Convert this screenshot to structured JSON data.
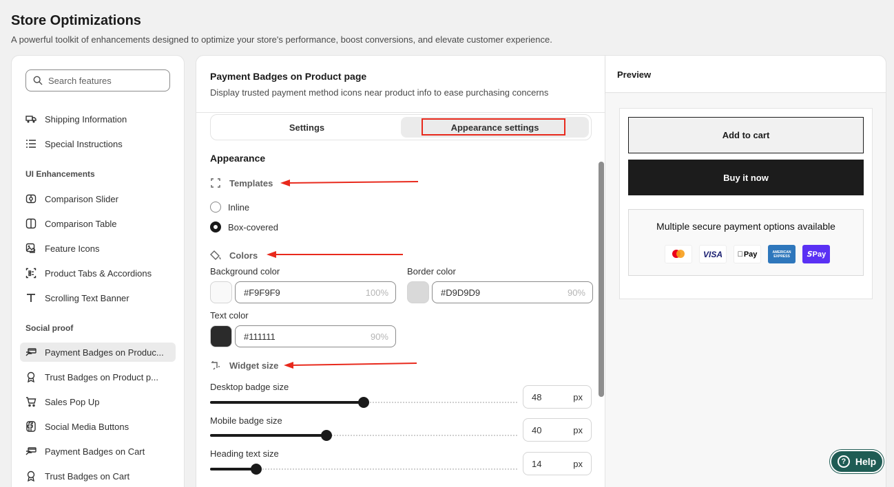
{
  "page": {
    "title": "Store Optimizations",
    "subtitle": "A powerful toolkit of enhancements designed to optimize your store's performance, boost conversions, and elevate customer experience."
  },
  "sidebar": {
    "search_placeholder": "Search features",
    "items_top": [
      {
        "label": "Shipping Information",
        "icon": "truck-icon"
      },
      {
        "label": "Special Instructions",
        "icon": "list-icon"
      }
    ],
    "sections": [
      {
        "title": "UI Enhancements",
        "items": [
          {
            "label": "Comparison Slider",
            "icon": "comparison-slider-icon"
          },
          {
            "label": "Comparison Table",
            "icon": "table-columns-icon"
          },
          {
            "label": "Feature Icons",
            "icon": "image-icon"
          },
          {
            "label": "Product Tabs & Accordions",
            "icon": "tabs-icon"
          },
          {
            "label": "Scrolling Text Banner",
            "icon": "text-icon"
          }
        ]
      },
      {
        "title": "Social proof",
        "items": [
          {
            "label": "Payment Badges on Produc...",
            "icon": "payment-hand-icon",
            "active": true
          },
          {
            "label": "Trust Badges on Product p...",
            "icon": "ribbon-badge-icon"
          },
          {
            "label": "Sales Pop Up",
            "icon": "cart-icon"
          },
          {
            "label": "Social Media Buttons",
            "icon": "social-icon"
          },
          {
            "label": "Payment Badges on Cart",
            "icon": "payment-hand-icon"
          },
          {
            "label": "Trust Badges on Cart",
            "icon": "ribbon-badge-icon"
          }
        ]
      }
    ]
  },
  "settings": {
    "title": "Payment Badges on Product page",
    "description": "Display trusted payment method icons near product info to ease purchasing concerns",
    "tabs": [
      {
        "label": "Settings",
        "active": false
      },
      {
        "label": "Appearance settings",
        "active": true
      }
    ],
    "appearance_title": "Appearance",
    "templates": {
      "heading": "Templates",
      "options": [
        {
          "label": "Inline",
          "selected": false
        },
        {
          "label": "Box-covered",
          "selected": true
        }
      ]
    },
    "colors": {
      "heading": "Colors",
      "background": {
        "label": "Background color",
        "value": "#F9F9F9",
        "opacity": "100%",
        "swatch": "#F9F9F9"
      },
      "border": {
        "label": "Border color",
        "value": "#D9D9D9",
        "opacity": "90%",
        "swatch": "#D9D9D9"
      },
      "text": {
        "label": "Text color",
        "value": "#111111",
        "opacity": "90%",
        "swatch": "#2b2b2b"
      }
    },
    "widget_size": {
      "heading": "Widget size",
      "sliders": [
        {
          "label": "Desktop badge size",
          "value": "48",
          "unit": "px",
          "fraction": 0.5
        },
        {
          "label": "Mobile badge size",
          "value": "40",
          "unit": "px",
          "fraction": 0.38
        },
        {
          "label": "Heading text size",
          "value": "14",
          "unit": "px",
          "fraction": 0.15
        }
      ]
    }
  },
  "preview": {
    "title": "Preview",
    "add_to_cart": "Add to cart",
    "buy_now": "Buy it now",
    "badge_heading": "Multiple secure payment options available",
    "badges": [
      {
        "name": "mastercard-icon",
        "label": ""
      },
      {
        "name": "visa-icon",
        "label": "VISA"
      },
      {
        "name": "apple-pay-icon",
        "label": "Pay"
      },
      {
        "name": "amex-icon",
        "label": "AMERICAN EXPRESS"
      },
      {
        "name": "shop-pay-icon",
        "label": "Pay"
      }
    ]
  },
  "help": {
    "label": "Help"
  },
  "colors": {
    "accent": "#1f5c54",
    "annotation": "#e8291c"
  }
}
